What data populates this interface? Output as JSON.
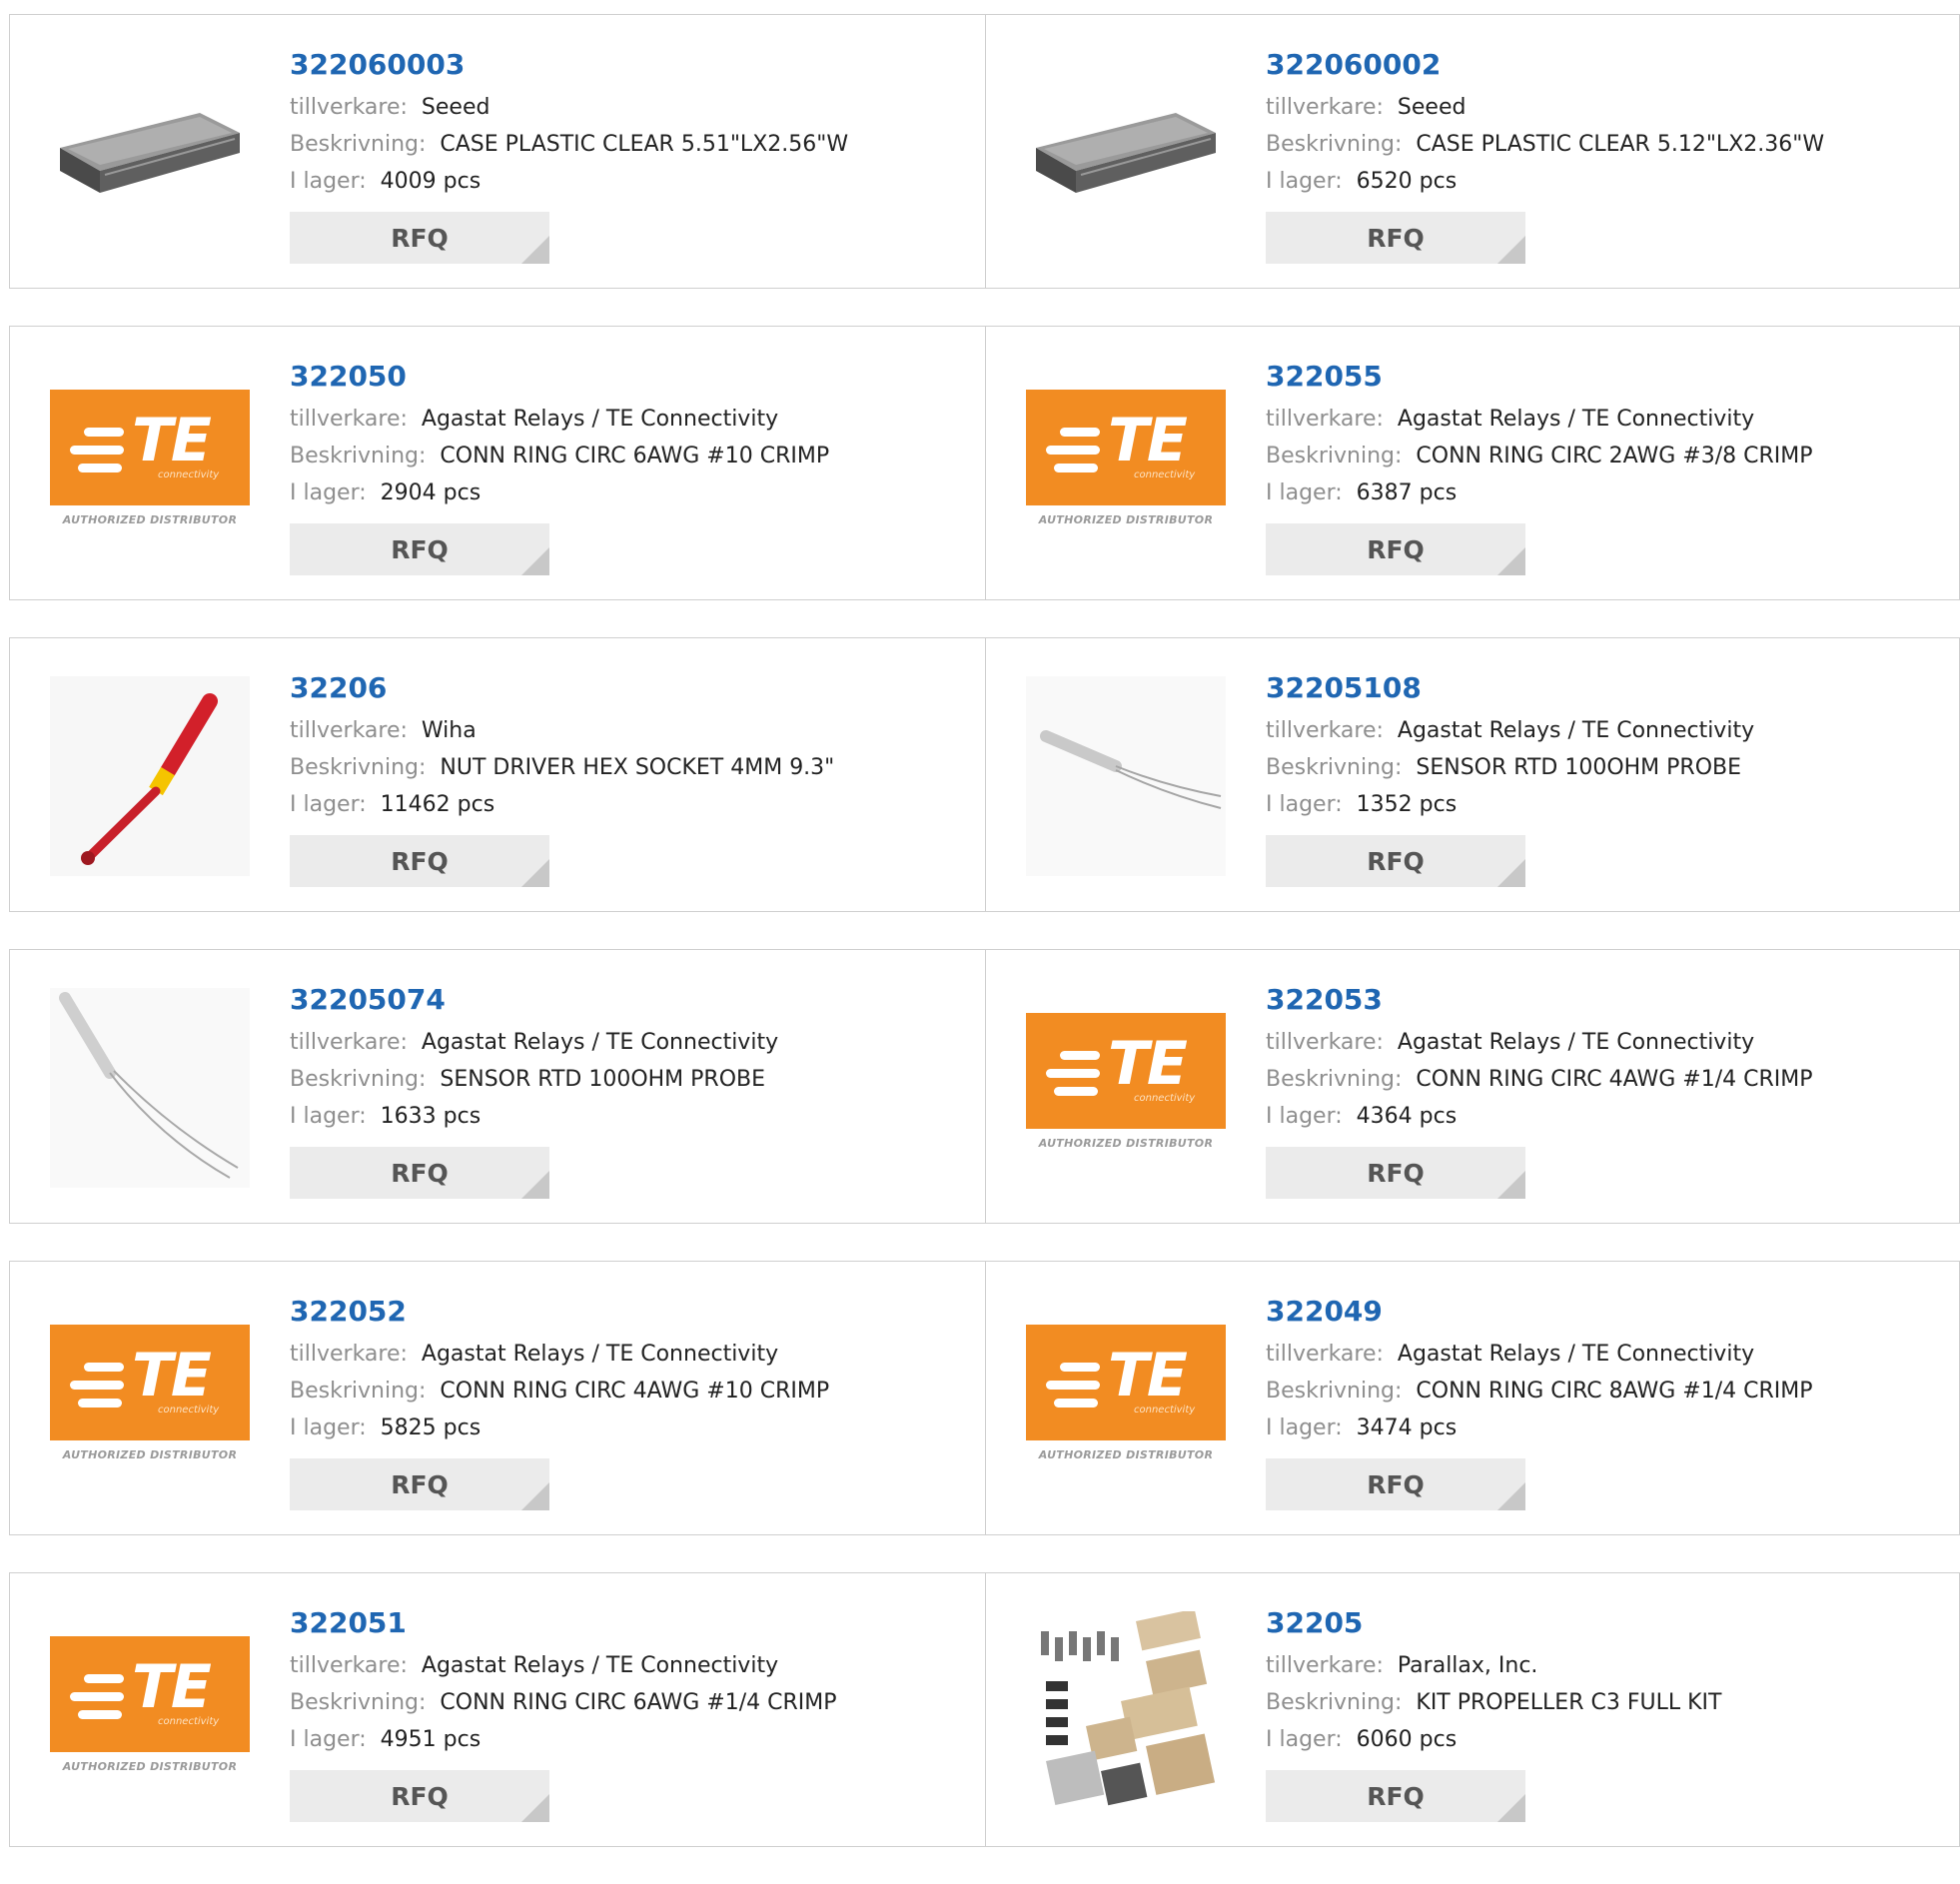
{
  "labels": {
    "manufacturer": "tillverkare:",
    "description": "Beskrivning:",
    "stock": "I lager:",
    "rfq": "RFQ"
  },
  "te_logo": {
    "mark": "TE",
    "sub": "connectivity",
    "authorized": "AUTHORIZED DISTRIBUTOR"
  },
  "products": [
    {
      "pn": "322060003",
      "mfr": "Seeed",
      "desc": "CASE PLASTIC CLEAR 5.51\"LX2.56\"W",
      "stock": "4009 pcs",
      "image": "clear-case"
    },
    {
      "pn": "322060002",
      "mfr": "Seeed",
      "desc": "CASE PLASTIC CLEAR 5.12\"LX2.36\"W",
      "stock": "6520 pcs",
      "image": "clear-case"
    },
    {
      "pn": "322050",
      "mfr": "Agastat Relays / TE Connectivity",
      "desc": "CONN RING CIRC 6AWG #10 CRIMP",
      "stock": "2904 pcs",
      "image": "te-logo"
    },
    {
      "pn": "322055",
      "mfr": "Agastat Relays / TE Connectivity",
      "desc": "CONN RING CIRC 2AWG #3/8 CRIMP",
      "stock": "6387 pcs",
      "image": "te-logo"
    },
    {
      "pn": "32206",
      "mfr": "Wiha",
      "desc": "NUT DRIVER HEX SOCKET 4MM 9.3\"",
      "stock": "11462 pcs",
      "image": "nut-driver"
    },
    {
      "pn": "32205108",
      "mfr": "Agastat Relays / TE Connectivity",
      "desc": "SENSOR RTD 100OHM PROBE",
      "stock": "1352 pcs",
      "image": "rtd-probe-horizontal"
    },
    {
      "pn": "32205074",
      "mfr": "Agastat Relays / TE Connectivity",
      "desc": "SENSOR RTD 100OHM PROBE",
      "stock": "1633 pcs",
      "image": "rtd-probe-diagonal"
    },
    {
      "pn": "322053",
      "mfr": "Agastat Relays / TE Connectivity",
      "desc": "CONN RING CIRC 4AWG #1/4 CRIMP",
      "stock": "4364 pcs",
      "image": "te-logo"
    },
    {
      "pn": "322052",
      "mfr": "Agastat Relays / TE Connectivity",
      "desc": "CONN RING CIRC 4AWG #10 CRIMP",
      "stock": "5825 pcs",
      "image": "te-logo"
    },
    {
      "pn": "322049",
      "mfr": "Agastat Relays / TE Connectivity",
      "desc": "CONN RING CIRC 8AWG #1/4 CRIMP",
      "stock": "3474 pcs",
      "image": "te-logo"
    },
    {
      "pn": "322051",
      "mfr": "Agastat Relays / TE Connectivity",
      "desc": "CONN RING CIRC 6AWG #1/4 CRIMP",
      "stock": "4951 pcs",
      "image": "te-logo"
    },
    {
      "pn": "32205",
      "mfr": "Parallax, Inc.",
      "desc": "KIT PROPELLER C3 FULL KIT",
      "stock": "6060 pcs",
      "image": "propeller-kit"
    }
  ]
}
